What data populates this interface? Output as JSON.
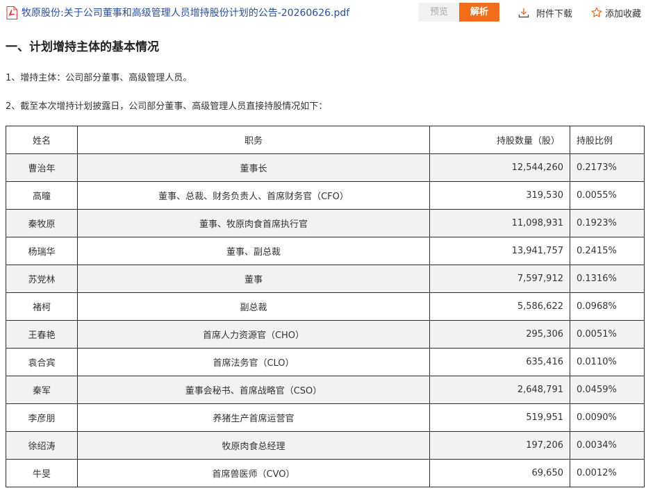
{
  "topbar": {
    "file_title": "牧原股份:关于公司董事和高级管理人员增持股份计划的公告-20260626.pdf",
    "preview_label": "预览",
    "parse_label": "解析",
    "download_label": "附件下载",
    "favorite_label": "添加收藏",
    "icons": {
      "file": "pdf-file-icon",
      "download": "download-icon",
      "favorite": "star-icon"
    },
    "colors": {
      "accent": "#f26e1a",
      "link": "#2b4f9e",
      "pdf_icon": "#e03a3a"
    }
  },
  "content": {
    "heading": "一、计划增持主体的基本情况",
    "para1": "1、增持主体：公司部分董事、高级管理人员。",
    "para2": "2、截至本次增持计划披露日，公司部分董事、高级管理人员直接持股情况如下："
  },
  "table": {
    "headers": [
      "姓名",
      "职务",
      "持股数量（股）",
      "持股比例"
    ],
    "rows": [
      [
        "曹治年",
        "董事长",
        "12,544,260",
        "0.2173%"
      ],
      [
        "高曈",
        "董事、总裁、财务负责人、首席财务官（CFO）",
        "319,530",
        "0.0055%"
      ],
      [
        "秦牧原",
        "董事、牧原肉食首席执行官",
        "11,098,931",
        "0.1923%"
      ],
      [
        "杨瑞华",
        "董事、副总裁",
        "13,941,757",
        "0.2415%"
      ],
      [
        "苏党林",
        "董事",
        "7,597,912",
        "0.1316%"
      ],
      [
        "褚柯",
        "副总裁",
        "5,586,622",
        "0.0968%"
      ],
      [
        "王春艳",
        "首席人力资源官（CHO）",
        "295,306",
        "0.0051%"
      ],
      [
        "袁合宾",
        "首席法务官（CLO）",
        "635,416",
        "0.0110%"
      ],
      [
        "秦军",
        "董事会秘书、首席战略官（CSO）",
        "2,648,791",
        "0.0459%"
      ],
      [
        "李彦朋",
        "养猪生产首席运营官",
        "519,951",
        "0.0090%"
      ],
      [
        "徐绍涛",
        "牧原肉食总经理",
        "197,206",
        "0.0034%"
      ],
      [
        "牛旻",
        "首席兽医师（CVO）",
        "69,650",
        "0.0012%"
      ]
    ]
  }
}
